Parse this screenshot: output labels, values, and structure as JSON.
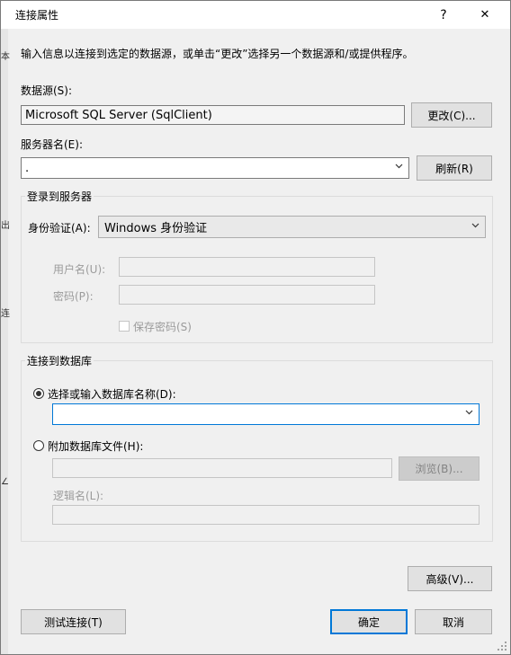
{
  "window": {
    "title": "连接属性",
    "help_glyph": "?",
    "close_glyph": "✕"
  },
  "background_fragments": [
    "本",
    "出",
    "连",
    "∠"
  ],
  "intro_text": "输入信息以连接到选定的数据源，或单击“更改”选择另一个数据源和/或提供程序。",
  "datasource": {
    "label": "数据源(S):",
    "value": "Microsoft SQL Server (SqlClient)",
    "change_button": "更改(C)..."
  },
  "server": {
    "label": "服务器名(E):",
    "value": ".",
    "refresh_button": "刷新(R)"
  },
  "login_group": {
    "title": "登录到服务器",
    "auth_label": "身份验证(A):",
    "auth_value": "Windows 身份验证",
    "username_label": "用户名(U):",
    "username_value": "",
    "password_label": "密码(P):",
    "password_value": "",
    "save_password_label": "保存密码(S)"
  },
  "db_group": {
    "title": "连接到数据库",
    "select_radio_label": "选择或输入数据库名称(D):",
    "select_value": "",
    "attach_radio_label": "附加数据库文件(H):",
    "attach_value": "",
    "browse_button": "浏览(B)...",
    "logical_name_label": "逻辑名(L):",
    "logical_name_value": ""
  },
  "buttons": {
    "advanced": "高级(V)...",
    "test": "测试连接(T)",
    "ok": "确定",
    "cancel": "取消"
  }
}
